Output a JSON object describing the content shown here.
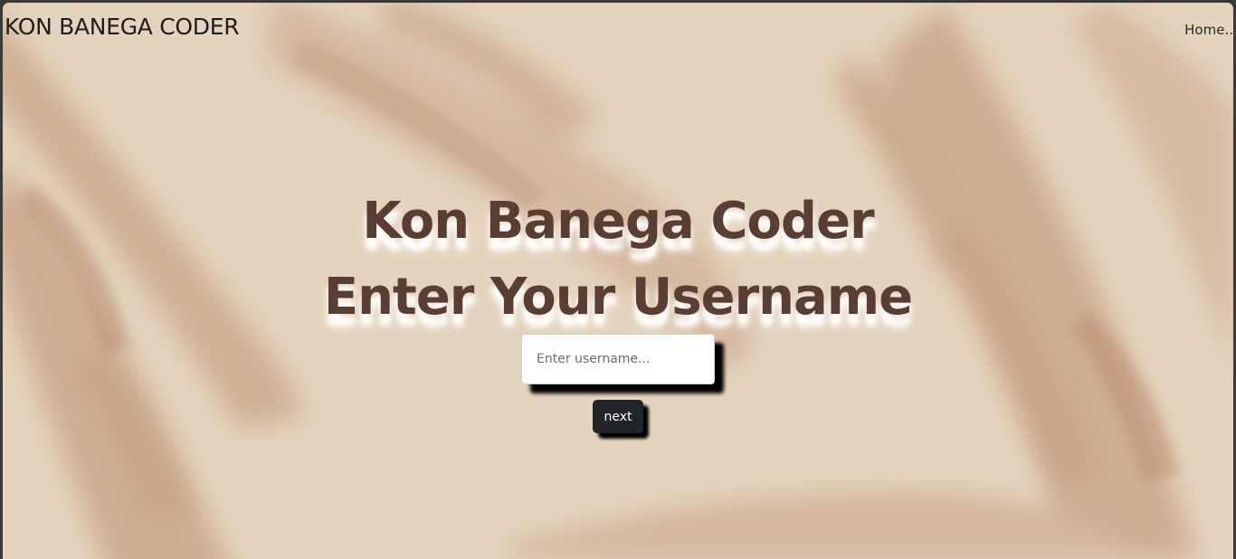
{
  "navbar": {
    "brand": "KON BANEGA CODER",
    "home_link": "Home.."
  },
  "hero": {
    "title_line1": "Kon Banega Coder",
    "title_line2": "Enter Your Username"
  },
  "form": {
    "username_placeholder": "Enter username...",
    "username_value": "",
    "next_label": "next"
  },
  "colors": {
    "background": "#e4d3bd",
    "brush_strokes": "#c8a587",
    "heading": "#5a3d33",
    "button": "#212529"
  }
}
